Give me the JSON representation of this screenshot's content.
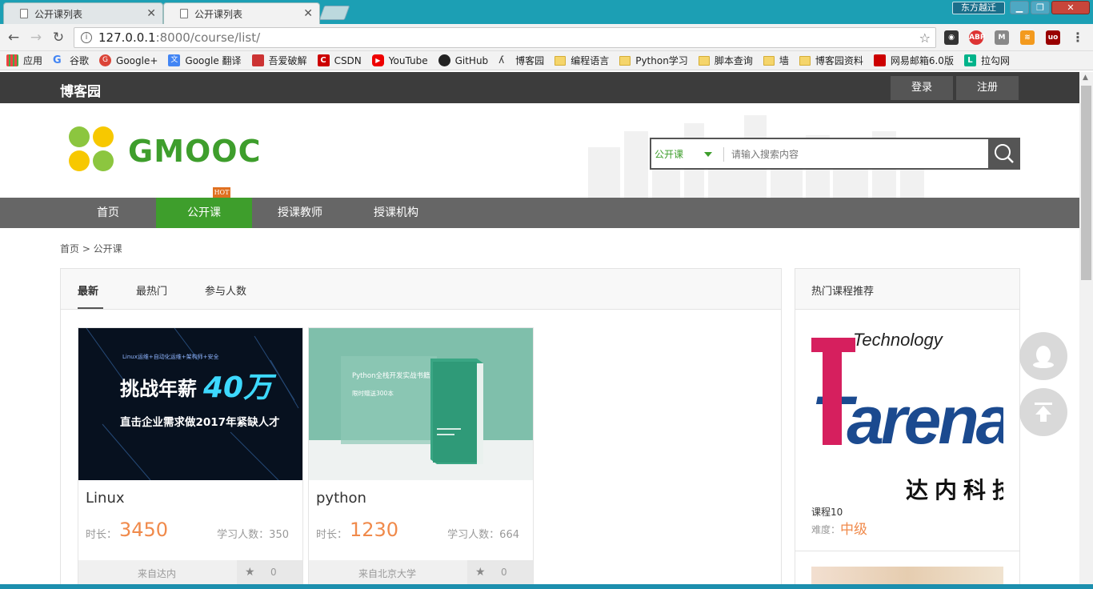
{
  "browser": {
    "tabs": [
      {
        "title": "公开课列表"
      },
      {
        "title": "公开课列表"
      }
    ],
    "window_title": "东方越迁",
    "url_host": "127.0.0.1",
    "url_path": ":8000/course/list/",
    "bookmarks": [
      {
        "label": "应用",
        "icon": "apps-icon"
      },
      {
        "label": "谷歌",
        "icon": "google-icon"
      },
      {
        "label": "Google+",
        "icon": "google-plus-icon"
      },
      {
        "label": "Google 翻译",
        "icon": "translate-icon"
      },
      {
        "label": "吾爱破解",
        "icon": "52pojie-icon"
      },
      {
        "label": "CSDN",
        "icon": "csdn-icon"
      },
      {
        "label": "YouTube",
        "icon": "youtube-icon"
      },
      {
        "label": "GitHub",
        "icon": "github-icon"
      },
      {
        "label": "博客园",
        "icon": "cnblogs-icon"
      },
      {
        "label": "编程语言",
        "icon": "folder-icon"
      },
      {
        "label": "Python学习",
        "icon": "folder-icon"
      },
      {
        "label": "脚本查询",
        "icon": "folder-icon"
      },
      {
        "label": "墙",
        "icon": "folder-icon"
      },
      {
        "label": "博客园资料",
        "icon": "folder-icon"
      },
      {
        "label": "网易邮箱6.0版",
        "icon": "netease-mail-icon"
      },
      {
        "label": "拉勾网",
        "icon": "lagou-icon"
      }
    ]
  },
  "site": {
    "name": "博客园",
    "login": "登录",
    "register": "注册",
    "brand": "GMOOC",
    "search_category": "公开课",
    "search_placeholder": "请输入搜索内容",
    "nav": [
      "首页",
      "公开课",
      "授课教师",
      "授课机构"
    ],
    "hot_badge": "HOT",
    "breadcrumb": "首页 > 公开课",
    "sort_tabs": [
      "最新",
      "最热门",
      "参与人数"
    ],
    "duration_label": "时长：",
    "courses": [
      {
        "name": "Linux",
        "duration": "3450",
        "students": "学习人数：350",
        "org": "来自达内",
        "favs": "0",
        "banner_top": "Linux运维+自动化运维+架构师+安全",
        "banner_main": "挑战年薪",
        "banner_num": "40万",
        "banner_sub": "直击企业需求做2017年紧缺人才"
      },
      {
        "name": "python",
        "duration": "1230",
        "students": "学习人数：664",
        "org": "来自北京大学",
        "favs": "0",
        "banner_main": "Python全栈开发实战书籍",
        "banner_sub": "限时赠送300本"
      }
    ],
    "hot_title": "热门课程推荐",
    "hot_course": {
      "logo_small": "Technology",
      "logo_main": "Tarena",
      "logo_cn": "达内科技",
      "name": "课程10",
      "level_label": "难度：",
      "level": "中级"
    }
  }
}
